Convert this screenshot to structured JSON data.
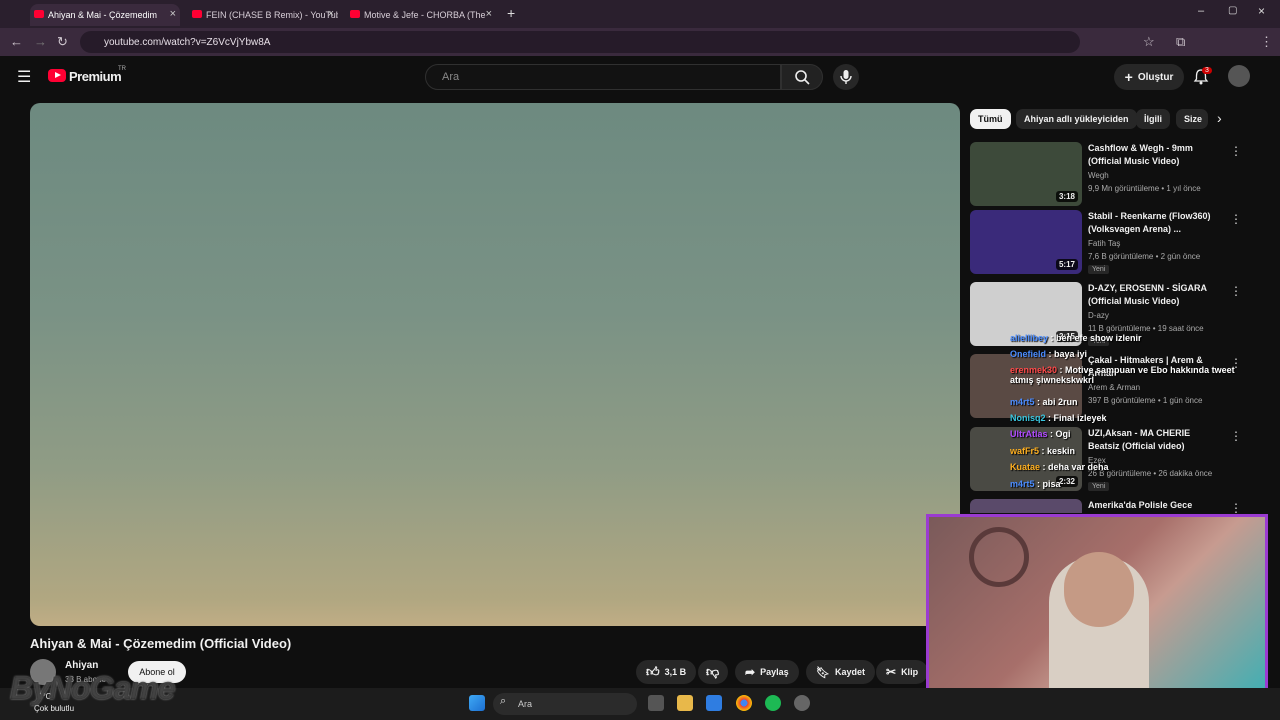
{
  "browser": {
    "tabs": [
      {
        "label": "Ahiyan & Mai - Çözemedim"
      },
      {
        "label": "FEIN (CHASE B Remix) - YouTube"
      },
      {
        "label": "Motive & Jefe - CHORBA (The"
      }
    ],
    "url": "youtube.com/watch?v=Z6VcVjYbw8A"
  },
  "header": {
    "logo_text": "Premium",
    "region": "TR",
    "search_placeholder": "Ara",
    "create_label": "Oluştur",
    "notification_count": "3"
  },
  "video": {
    "title": "Ahiyan & Mai - Çözemedim (Official Video)",
    "channel": "Ahiyan",
    "subs": "33 B abone",
    "subscribe_label": "Abone ol",
    "likes": "3,1 B",
    "share_label": "Paylaş",
    "save_label": "Kaydet",
    "clip_label": "Klip"
  },
  "chips": [
    "Tümü",
    "Ahiyan adlı yükleyiciden",
    "İlgili",
    "Size"
  ],
  "recommendations": [
    {
      "title": "Cashflow & Wegh - 9mm (Official Music Video)",
      "channel": "Wegh",
      "meta": "9,9 Mn görüntüleme • 1 yıl önce",
      "duration": "3:18",
      "badge": "",
      "thumb": "#3d4a3a"
    },
    {
      "title": "Stabil - Reenkarne (Flow360) (Volksvagen Arena) ...",
      "channel": "Fatih Taş",
      "meta": "7,6 B görüntüleme • 2 gün önce",
      "duration": "5:17",
      "badge": "Yeni",
      "thumb": "#3a2a7a"
    },
    {
      "title": "D-AZY, EROSENN - SİGARA (Official Music Video)",
      "channel": "D-azy",
      "meta": "11 B görüntüleme • 19 saat önce",
      "duration": "2:15",
      "badge": "Yeni",
      "thumb": "#cfcfcf"
    },
    {
      "title": "Çakal - Hitmakers | Arem & Arman",
      "channel": "Arem & Arman",
      "meta": "397 B görüntüleme • 1 gün önce",
      "duration": "",
      "badge": "",
      "thumb": "#5a4a44"
    },
    {
      "title": "UZI,Aksan - MA CHERIE Beatsiz (Official video)",
      "channel": "Ezex",
      "meta": "26 B görüntüleme • 26 dakika önce",
      "duration": "2:32",
      "badge": "Yeni",
      "thumb": "#4a4a44"
    },
    {
      "title": "Amerika'da Polisle Gece",
      "channel": "",
      "meta": "",
      "duration": "",
      "badge": "",
      "thumb": "#5a4a6a"
    }
  ],
  "chat": [
    {
      "user": "aliellibey",
      "text": "ben efe show izlenir",
      "color": "#4a8cff"
    },
    {
      "user": "Onefield",
      "text": "baya iyi",
      "color": "#4a8cff"
    },
    {
      "user": "erenmek30",
      "text": "Motive şampuan ve Ebo hakkında tweet atmış şiwnekskwkrl",
      "color": "#ff4a4a"
    },
    {
      "user": "m4rt5",
      "text": "abi 2run",
      "color": "#4a8cff"
    },
    {
      "user": "Nonisq2",
      "text": "Final izleyek",
      "color": "#3ac7e0"
    },
    {
      "user": "UltrAtlas",
      "text": "Ogi",
      "color": "#b04aff"
    },
    {
      "user": "wafFr5",
      "text": "keskin",
      "color": "#ffb020"
    },
    {
      "user": "Kuatae",
      "text": "deha var deha",
      "color": "#ffb020"
    },
    {
      "user": "m4rt5",
      "text": "pisa",
      "color": "#4a8cff"
    }
  ],
  "taskbar": {
    "search_label": "Ara",
    "weather_temp": "0°C",
    "weather_desc": "Çok bulutlu"
  },
  "watermark": "ByNoGame"
}
